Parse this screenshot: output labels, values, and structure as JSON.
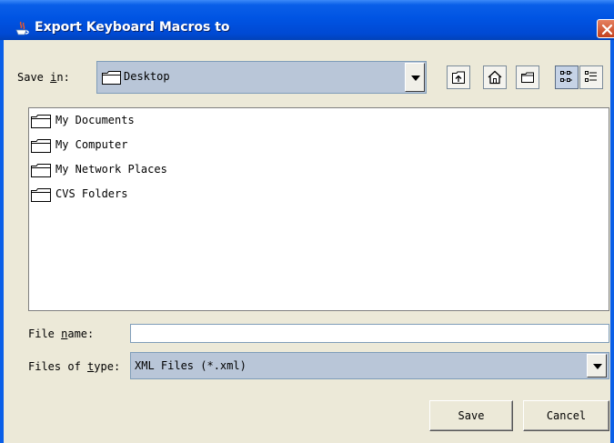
{
  "window": {
    "title": "Export Keyboard Macros to"
  },
  "save_in": {
    "label_pre": "Save ",
    "label_mn": "i",
    "label_post": "n:",
    "value": "Desktop"
  },
  "toolbar": {
    "buttons": [
      "up-one-level",
      "home",
      "new-folder",
      "list-view",
      "details-view"
    ]
  },
  "files": [
    {
      "name": "My Documents",
      "icon": "folder-icon"
    },
    {
      "name": "My Computer",
      "icon": "folder-icon"
    },
    {
      "name": "My Network Places",
      "icon": "folder-icon"
    },
    {
      "name": "CVS Folders",
      "icon": "folder-icon"
    }
  ],
  "file_name": {
    "label_pre": "File ",
    "label_mn": "n",
    "label_post": "ame:",
    "value": ""
  },
  "file_type": {
    "label_pre": "Files of ",
    "label_mn": "t",
    "label_post": "ype:",
    "value": "XML Files (*.xml)"
  },
  "buttons": {
    "save": "Save",
    "cancel": "Cancel"
  },
  "colors": {
    "title_bar": "#0054e3",
    "dialog_bg": "#ece9d8",
    "combo_bg": "#b9c6d8",
    "close_button": "#d95a34"
  }
}
